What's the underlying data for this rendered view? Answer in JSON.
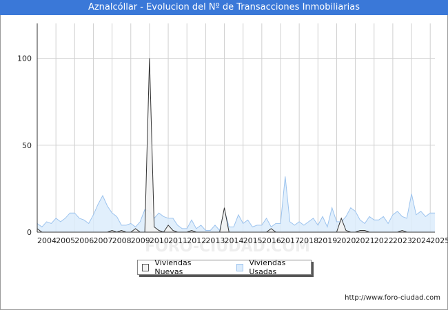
{
  "title": "Aznalcóllar - Evolucion del Nº de Transacciones Inmobiliarias",
  "source_text": "http://www.foro-ciudad.com",
  "watermark": "FORO-CIUDAD.COM",
  "colors": {
    "title_bg": "#3a78d8",
    "nuevas_fill": "#f2f2f2",
    "nuevas_line": "#333333",
    "usadas_fill": "#dcecfc",
    "usadas_line": "#9cc3ee",
    "grid": "#d0d0d0"
  },
  "chart_data": {
    "type": "area",
    "title": "Aznalcóllar - Evolucion del Nº de Transacciones Inmobiliarias",
    "xlabel": "",
    "ylabel": "",
    "ylim": [
      0,
      120
    ],
    "xlim": [
      2004,
      2025.25
    ],
    "grid": true,
    "legend_position": "bottom-center",
    "x_ticks": [
      "2004",
      "2005",
      "2006",
      "2007",
      "2008",
      "2009",
      "2010",
      "2011",
      "2012",
      "2013",
      "2014",
      "2015",
      "2016",
      "2017",
      "2018",
      "2019",
      "2020",
      "2021",
      "2022",
      "2023",
      "2024",
      "2025"
    ],
    "y_ticks": [
      0,
      50,
      100
    ],
    "x_start": 2004,
    "x_step": 0.25,
    "series": [
      {
        "name": "Viviendas Nuevas",
        "values": [
          2,
          0,
          0,
          0,
          0,
          0,
          0,
          0,
          0,
          0,
          0,
          0,
          0,
          0,
          0,
          0,
          1,
          0,
          1,
          0,
          0,
          2,
          0,
          0,
          100,
          3,
          1,
          0,
          4,
          1,
          0,
          0,
          0,
          1,
          0,
          0,
          0,
          0,
          0,
          0,
          14,
          0,
          0,
          0,
          0,
          0,
          0,
          0,
          0,
          0,
          2,
          0,
          0,
          0,
          0,
          0,
          0,
          0,
          0,
          0,
          0,
          0,
          0,
          0,
          0,
          8,
          1,
          0,
          0,
          1,
          1,
          0,
          0,
          0,
          0,
          0,
          0,
          0,
          1,
          0,
          0,
          0,
          0,
          0
        ]
      },
      {
        "name": "Viviendas Usadas",
        "values": [
          5,
          3,
          6,
          5,
          8,
          6,
          8,
          11,
          11,
          8,
          7,
          5,
          10,
          16,
          21,
          15,
          11,
          9,
          4,
          4,
          5,
          3,
          6,
          13,
          12,
          8,
          11,
          9,
          8,
          8,
          4,
          2,
          2,
          7,
          2,
          4,
          1,
          1,
          4,
          1,
          13,
          3,
          3,
          10,
          5,
          7,
          3,
          4,
          4,
          8,
          3,
          5,
          5,
          32,
          6,
          4,
          6,
          4,
          6,
          8,
          4,
          9,
          3,
          14,
          6,
          6,
          9,
          14,
          12,
          7,
          5,
          9,
          7,
          7,
          9,
          5,
          10,
          12,
          9,
          8,
          22,
          10,
          12,
          9,
          11,
          11
        ]
      }
    ]
  }
}
